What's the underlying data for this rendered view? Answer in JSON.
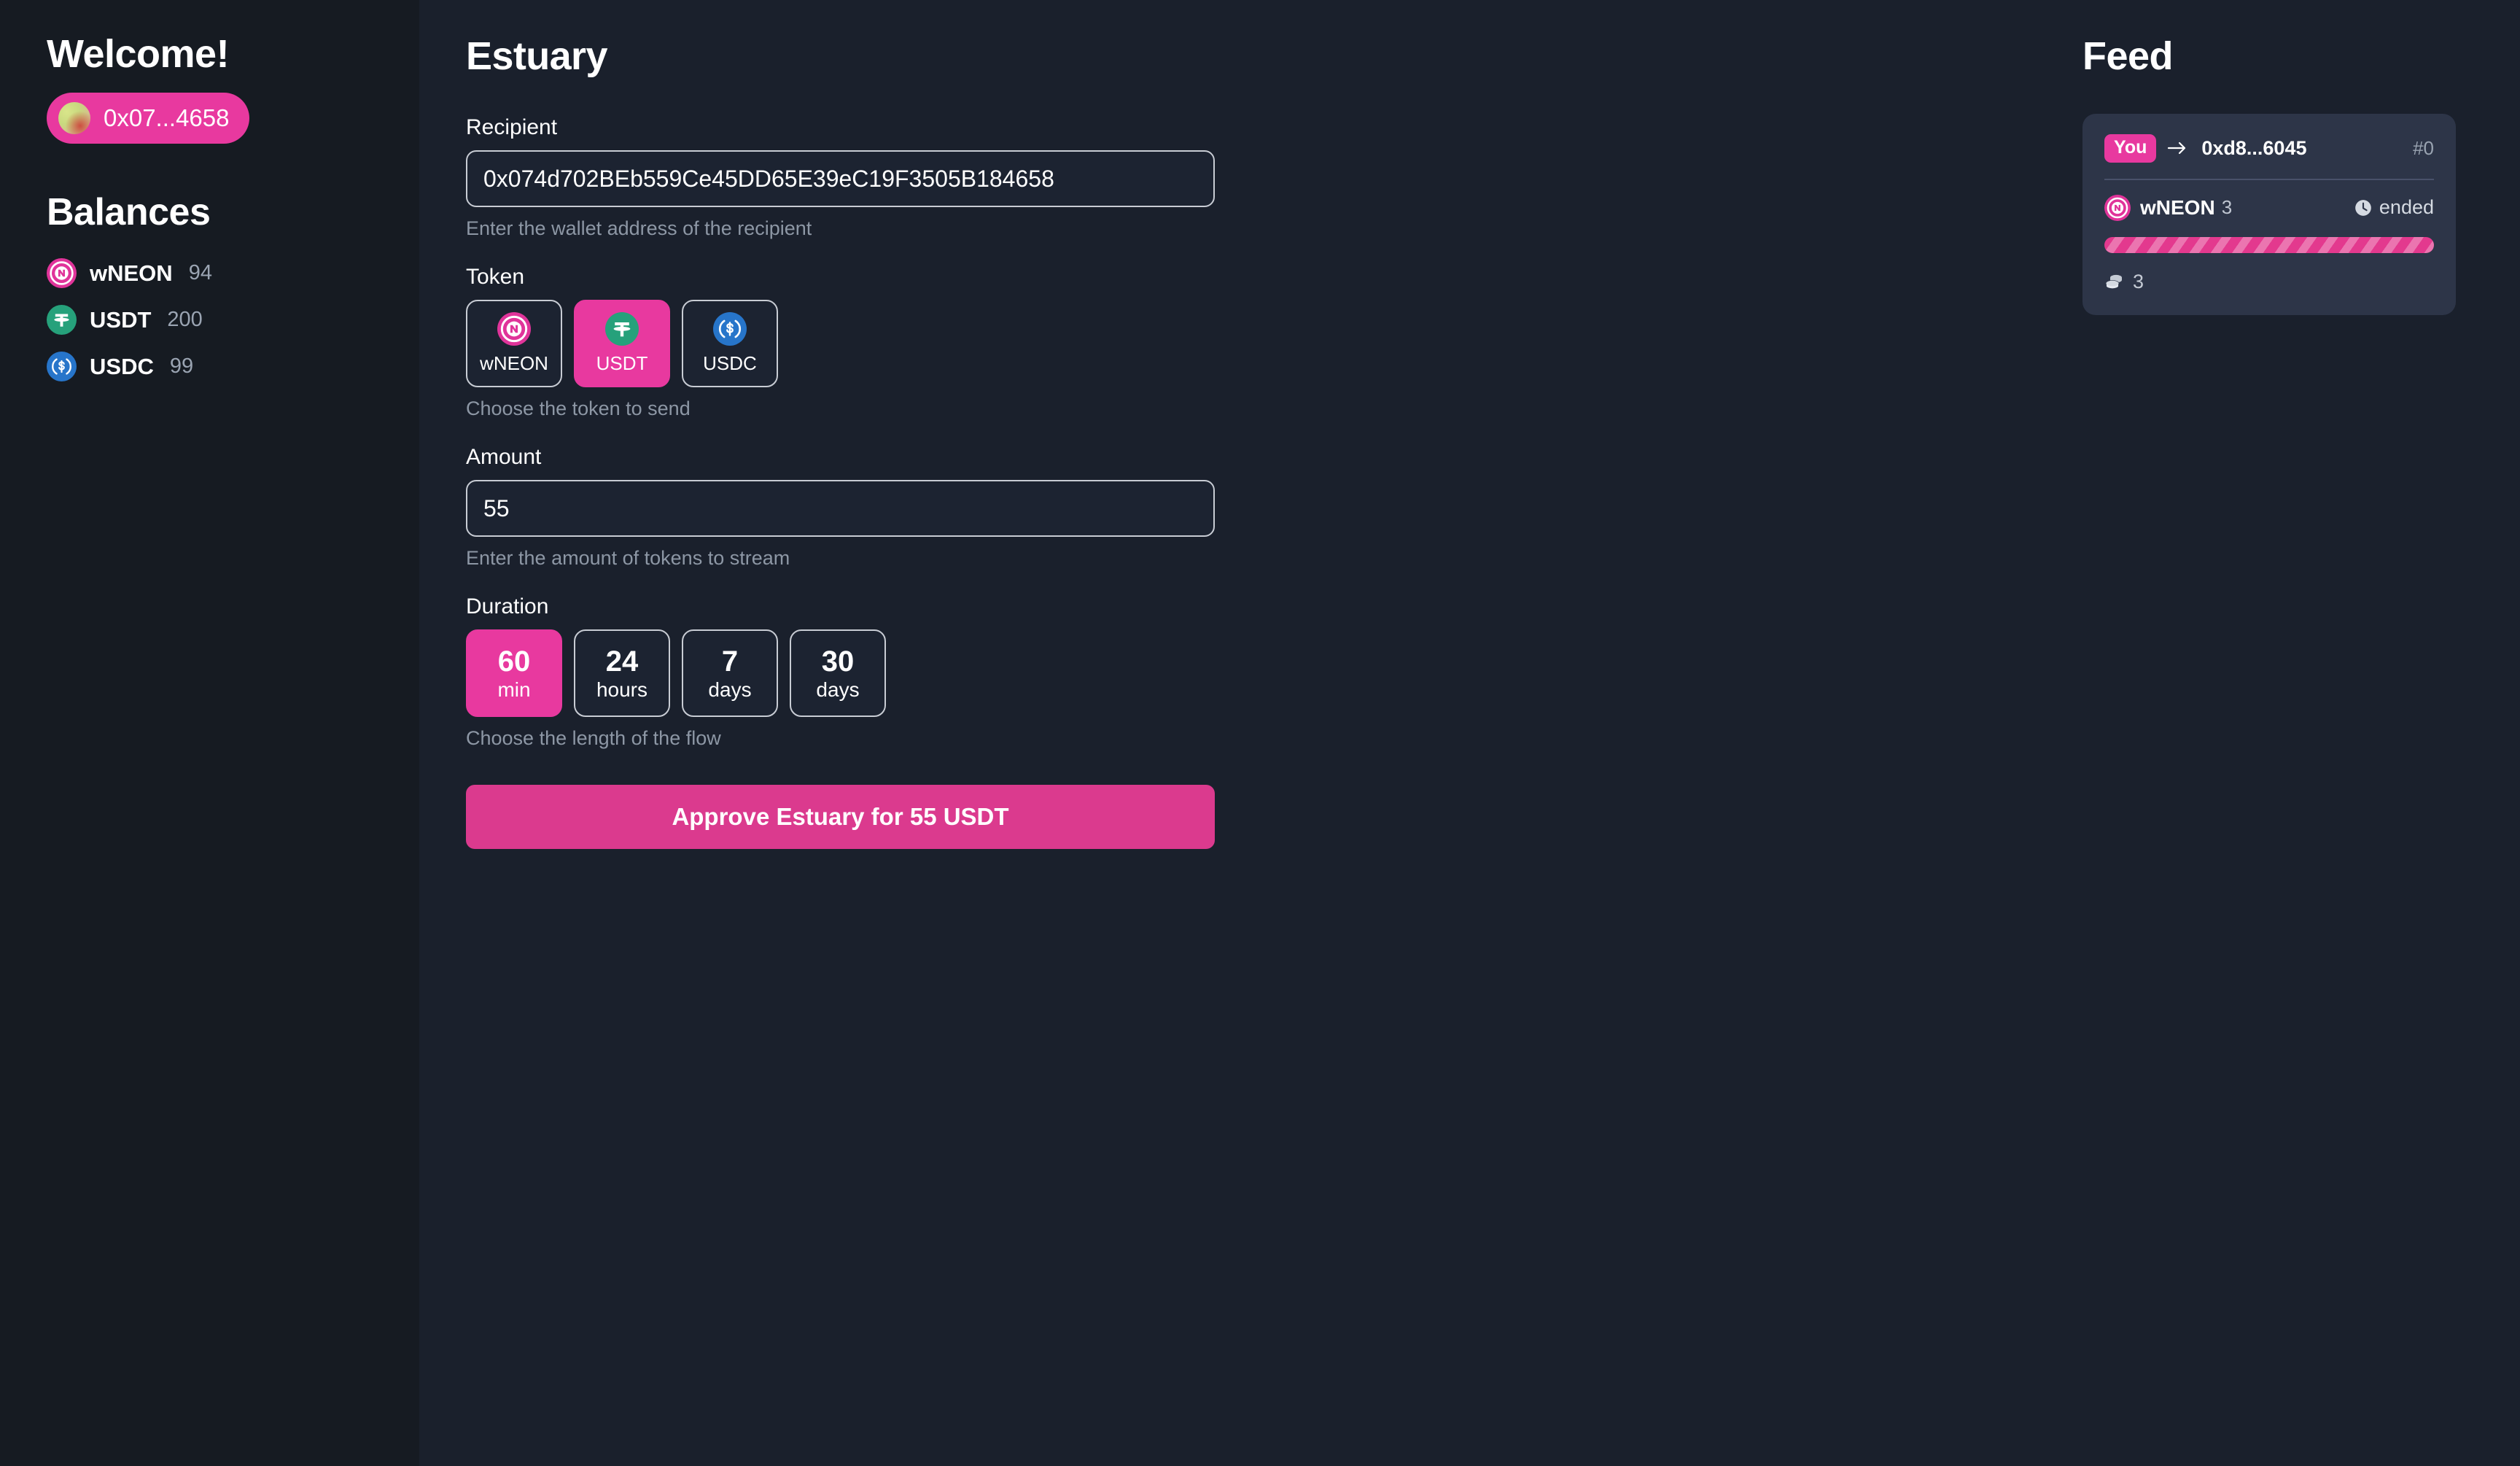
{
  "theme": {
    "sidebar_bg": "#161b22",
    "main_bg": "#1a202c",
    "accent_pink": "#e8399f",
    "button_pink": "#db3a8e",
    "card_bg": "#2d3548",
    "muted_text": "#8d97a5",
    "usdt_green": "#26a17b",
    "usdc_blue": "#2775ca",
    "wneon_pink": "#e0349a"
  },
  "sidebar": {
    "welcome_title": "Welcome!",
    "wallet": {
      "address_short": "0x07...4658",
      "avatar_icon": "wallet-avatar-blob"
    },
    "balances_title": "Balances",
    "balances": [
      {
        "symbol": "wNEON",
        "amount": "94",
        "icon": "wneon-token-icon"
      },
      {
        "symbol": "USDT",
        "amount": "200",
        "icon": "usdt-token-icon"
      },
      {
        "symbol": "USDC",
        "amount": "99",
        "icon": "usdc-token-icon"
      }
    ]
  },
  "main": {
    "page_title": "Estuary",
    "recipient": {
      "label": "Recipient",
      "value": "0x074d702BEb559Ce45DD65E39eC19F3505B184658",
      "placeholder": "0x...",
      "hint": "Enter the wallet address of the recipient"
    },
    "token": {
      "label": "Token",
      "hint": "Choose the token to send",
      "selected": "USDT",
      "options": [
        {
          "symbol": "wNEON",
          "icon": "wneon-token-icon",
          "selected": false
        },
        {
          "symbol": "USDT",
          "icon": "usdt-token-icon",
          "selected": true
        },
        {
          "symbol": "USDC",
          "icon": "usdc-token-icon",
          "selected": false
        }
      ]
    },
    "amount": {
      "label": "Amount",
      "value": "55",
      "placeholder": "0.0",
      "hint": "Enter the amount of tokens to stream"
    },
    "duration": {
      "label": "Duration",
      "hint": "Choose the length of the flow",
      "selected": "60 min",
      "options": [
        {
          "number": "60",
          "unit": "min",
          "selected": true
        },
        {
          "number": "24",
          "unit": "hours",
          "selected": false
        },
        {
          "number": "7",
          "unit": "days",
          "selected": false
        },
        {
          "number": "30",
          "unit": "days",
          "selected": false
        }
      ]
    },
    "approve_button_label": "Approve Estuary for 55 USDT"
  },
  "feed": {
    "title": "Feed",
    "items": [
      {
        "sender_badge": "You",
        "arrow_icon": "arrow-right-icon",
        "recipient_short": "0xd8...6045",
        "index": "#0",
        "token_symbol": "wNEON",
        "token_icon": "wneon-token-icon",
        "token_amount": "3",
        "status_icon": "clock-icon",
        "status": "ended",
        "progress_percent": 100,
        "coins_icon": "coins-icon",
        "withdrawn": "3"
      }
    ]
  }
}
